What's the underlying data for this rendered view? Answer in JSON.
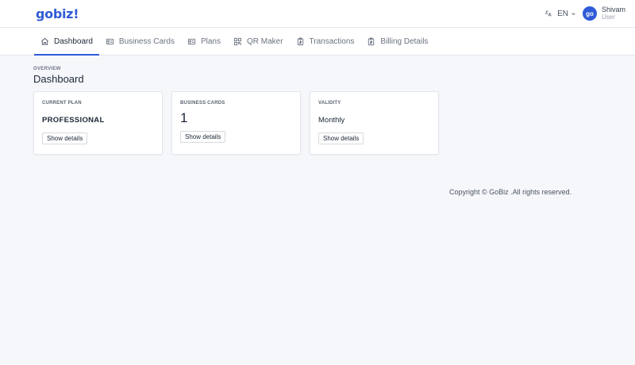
{
  "brand": {
    "logo": "gobiz!"
  },
  "header": {
    "lang": "EN",
    "avatar_initials": "go",
    "user_name": "Shivam",
    "user_role": "User"
  },
  "nav": {
    "items": [
      {
        "label": "Dashboard",
        "icon": "home-icon",
        "active": true
      },
      {
        "label": "Business Cards",
        "icon": "id-card-icon"
      },
      {
        "label": "Plans",
        "icon": "id-card-icon"
      },
      {
        "label": "QR Maker",
        "icon": "qr-code-icon"
      },
      {
        "label": "Transactions",
        "icon": "clipboard-icon"
      },
      {
        "label": "Billing Details",
        "icon": "clipboard-icon"
      }
    ]
  },
  "page": {
    "pretitle": "OVERVIEW",
    "title": "Dashboard"
  },
  "cards": [
    {
      "label": "CURRENT PLAN",
      "value": "PROFESSIONAL",
      "button": "Show details"
    },
    {
      "label": "BUSINESS CARDS",
      "value": "1",
      "button": "Show details"
    },
    {
      "label": "VALIDITY",
      "value": "Monthly",
      "button": "Show details"
    }
  ],
  "footer": {
    "text": "Copyright © GoBiz .All rights reserved."
  },
  "colors": {
    "accent": "#2f5bd6",
    "background": "#f5f7fb"
  }
}
